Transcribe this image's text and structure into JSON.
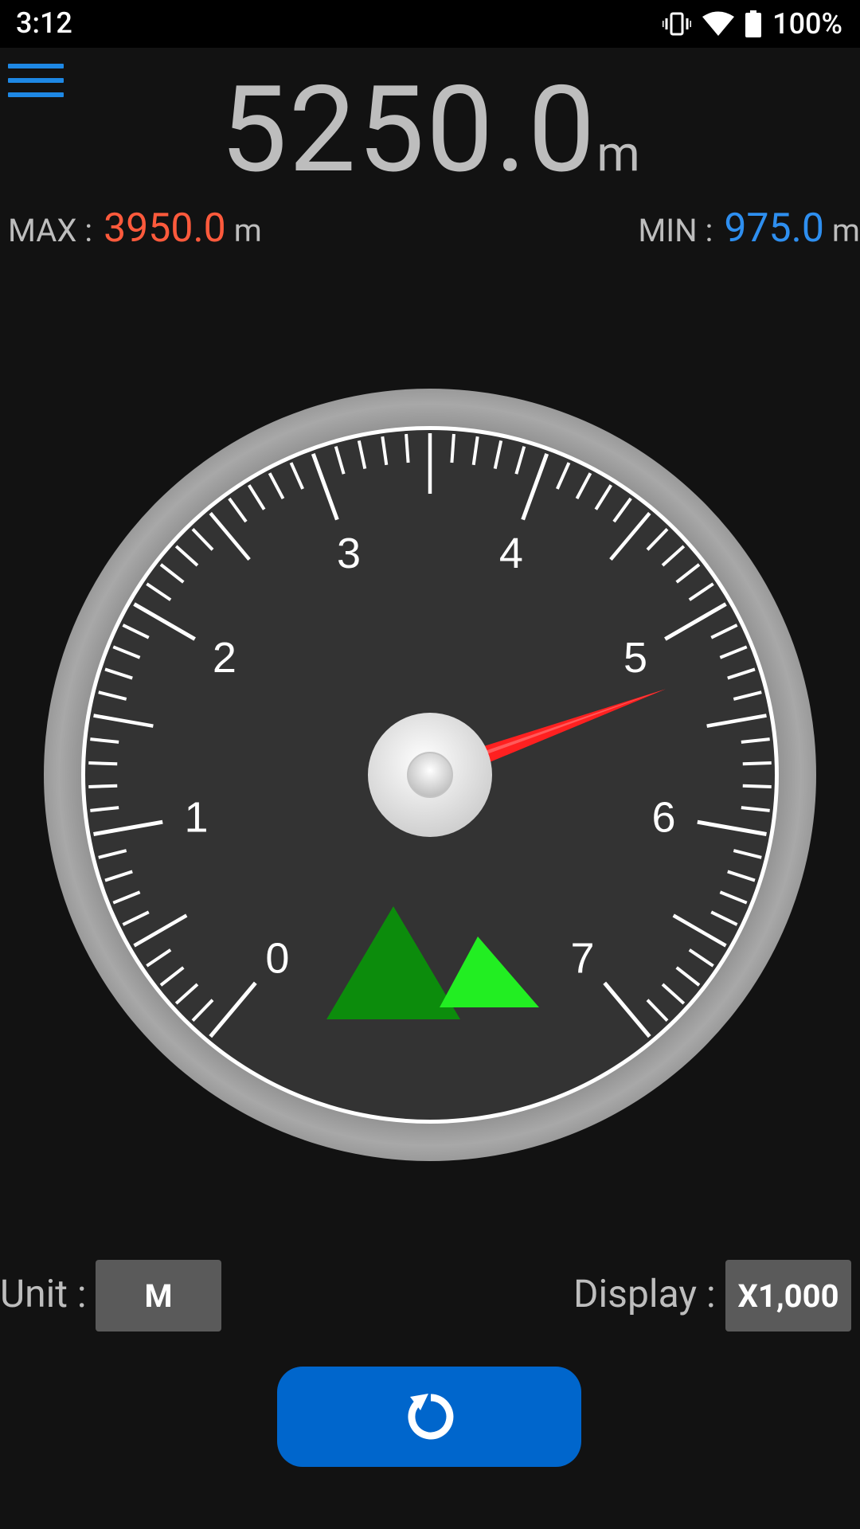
{
  "status_bar": {
    "time": "3:12",
    "battery_percent": "100%",
    "icons": [
      "vibrate-icon",
      "wifi-icon",
      "battery-icon"
    ]
  },
  "menu": {
    "icon": "hamburger-menu-icon",
    "color": "#1e88e5"
  },
  "reading": {
    "value": "5250.0",
    "unit": "m"
  },
  "max": {
    "label": "MAX :",
    "value": "3950.0",
    "unit": "m",
    "color": "#ff5a3c"
  },
  "min": {
    "label": "MIN :",
    "value": "975.0",
    "unit": "m",
    "color": "#2e8ff0"
  },
  "gauge": {
    "scale_labels": [
      "0",
      "1",
      "2",
      "3",
      "4",
      "5",
      "6",
      "7"
    ],
    "needle_value": 5.25,
    "needle_color": "#ff2020",
    "face_color": "#333333",
    "icon": "mountain-icon"
  },
  "controls": {
    "unit_label": "Unit :",
    "unit_value": "M",
    "display_label": "Display :",
    "display_value": "X1,000",
    "reset_icon": "reset-icon",
    "reset_color": "#0066cc"
  }
}
